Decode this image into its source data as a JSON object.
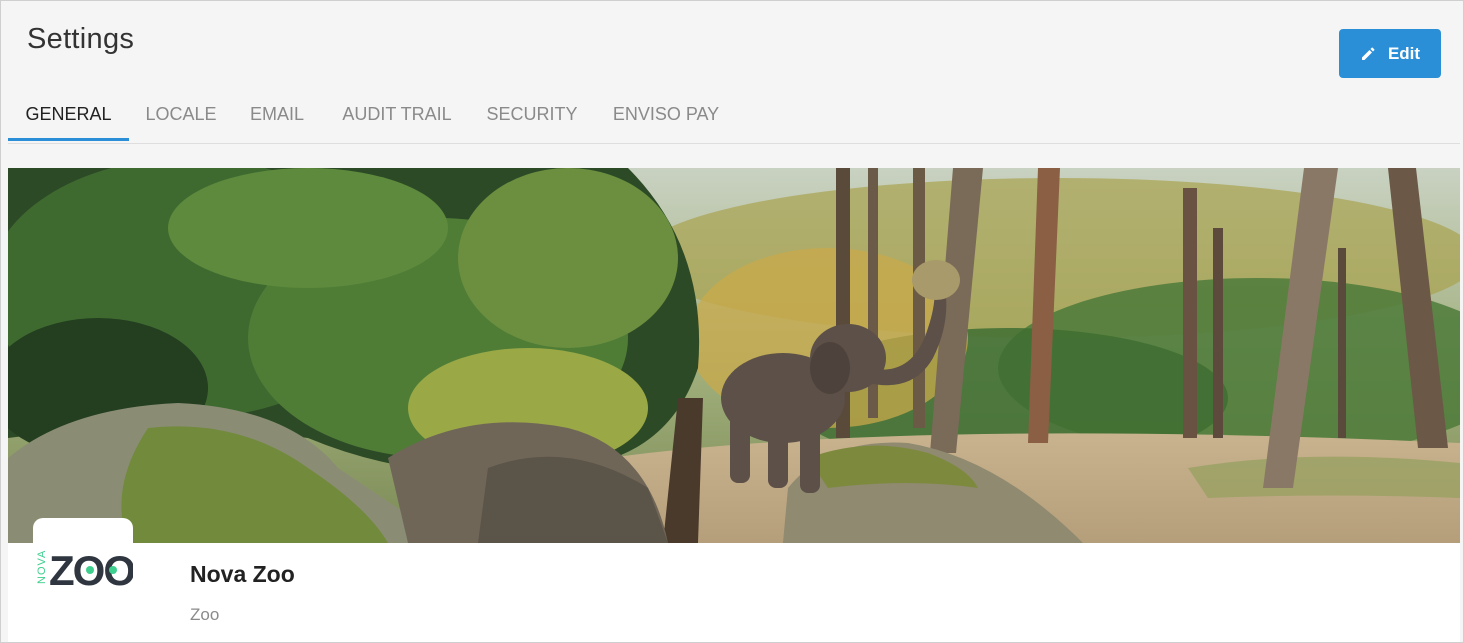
{
  "header": {
    "title": "Settings",
    "edit_label": "Edit"
  },
  "tabs": [
    {
      "label": "GENERAL",
      "active": true
    },
    {
      "label": "LOCALE",
      "active": false
    },
    {
      "label": "EMAIL",
      "active": false
    },
    {
      "label": "AUDIT TRAIL",
      "active": false
    },
    {
      "label": "SECURITY",
      "active": false
    },
    {
      "label": "ENVISO PAY",
      "active": false
    }
  ],
  "profile": {
    "name": "Nova Zoo",
    "type": "Zoo",
    "logo": {
      "small_text": "NOVA",
      "big_text": "ZOO"
    }
  },
  "colors": {
    "accent": "#2b8fd8",
    "logo_dark": "#2f3640",
    "logo_green": "#3ecf8e"
  }
}
